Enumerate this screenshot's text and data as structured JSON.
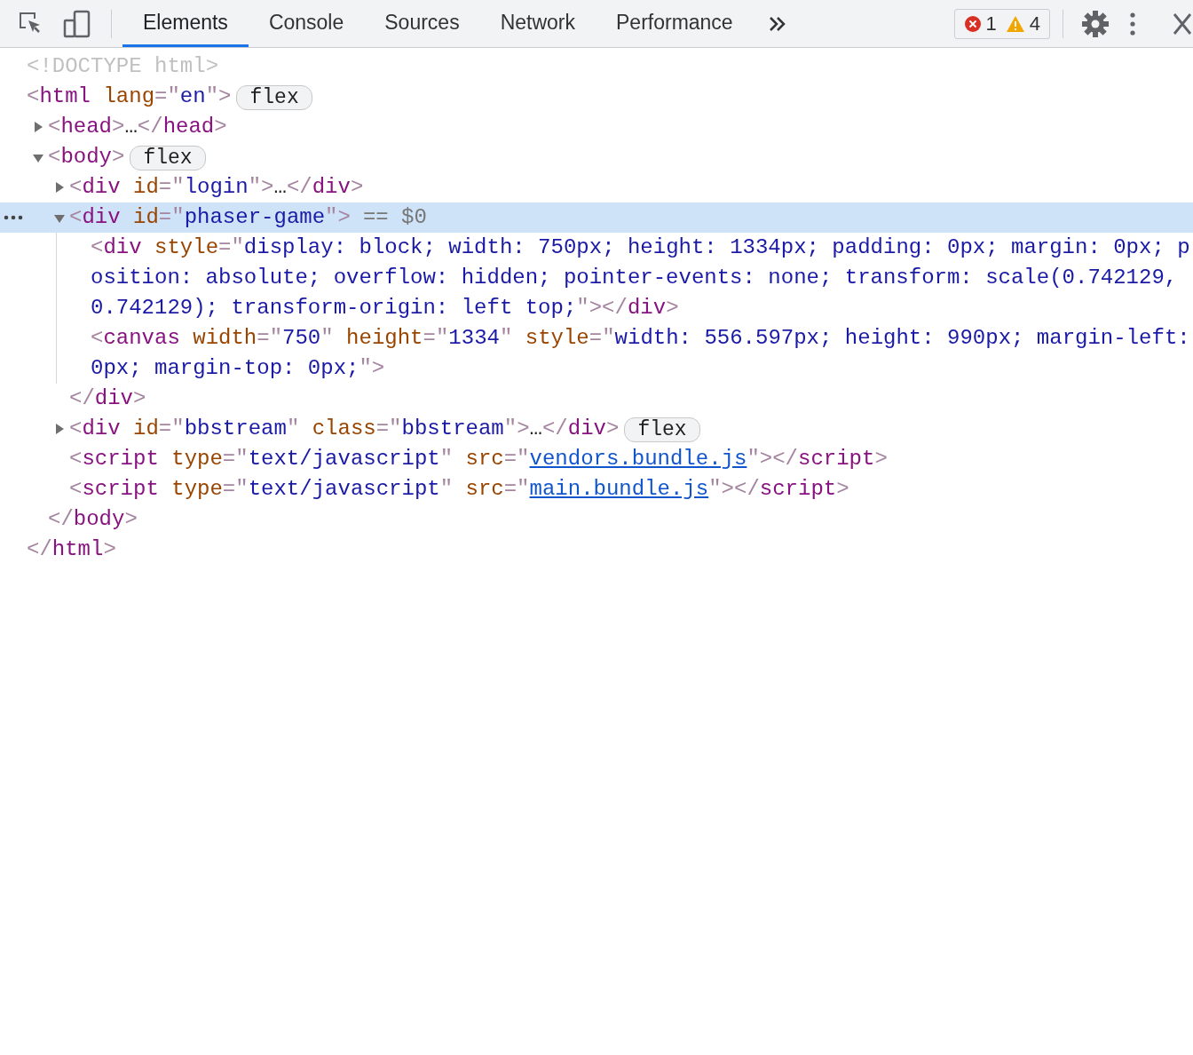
{
  "toolbar": {
    "tabs": [
      {
        "label": "Elements",
        "selected": true
      },
      {
        "label": "Console",
        "selected": false
      },
      {
        "label": "Sources",
        "selected": false
      },
      {
        "label": "Network",
        "selected": false
      },
      {
        "label": "Performance",
        "selected": false
      }
    ],
    "issues": {
      "errors": "1",
      "warnings": "4"
    }
  },
  "dom_tree": [
    {
      "open": [
        {
          "kind": "doctype",
          "text": "<!DOCTYPE html>"
        }
      ]
    },
    {
      "open": [
        {
          "kind": "punct",
          "text": "<"
        },
        {
          "kind": "tag",
          "text": "html"
        },
        {
          "kind": "attr",
          "text": " lang"
        },
        {
          "kind": "punct",
          "text": "=\""
        },
        {
          "kind": "value",
          "text": "en"
        },
        {
          "kind": "punct",
          "text": "\">"
        }
      ],
      "badge": "flex",
      "children": [
        {
          "expanded": false,
          "open": [
            {
              "kind": "punct",
              "text": "<"
            },
            {
              "kind": "tag",
              "text": "head"
            },
            {
              "kind": "punct",
              "text": ">"
            },
            {
              "kind": "ellipsis",
              "text": "…"
            },
            {
              "kind": "punct",
              "text": "</"
            },
            {
              "kind": "tag",
              "text": "head"
            },
            {
              "kind": "punct",
              "text": ">"
            }
          ]
        },
        {
          "expanded": true,
          "open": [
            {
              "kind": "punct",
              "text": "<"
            },
            {
              "kind": "tag",
              "text": "body"
            },
            {
              "kind": "punct",
              "text": ">"
            }
          ],
          "badge": "flex",
          "children": [
            {
              "expanded": false,
              "open": [
                {
                  "kind": "punct",
                  "text": "<"
                },
                {
                  "kind": "tag",
                  "text": "div"
                },
                {
                  "kind": "attr",
                  "text": " id"
                },
                {
                  "kind": "punct",
                  "text": "=\""
                },
                {
                  "kind": "value",
                  "text": "login"
                },
                {
                  "kind": "punct",
                  "text": "\">"
                },
                {
                  "kind": "ellipsis",
                  "text": "…"
                },
                {
                  "kind": "punct",
                  "text": "</"
                },
                {
                  "kind": "tag",
                  "text": "div"
                },
                {
                  "kind": "punct",
                  "text": ">"
                }
              ]
            },
            {
              "expanded": true,
              "selected": true,
              "marker": "== $0",
              "open": [
                {
                  "kind": "punct",
                  "text": "<"
                },
                {
                  "kind": "tag",
                  "text": "div"
                },
                {
                  "kind": "attr",
                  "text": " id"
                },
                {
                  "kind": "punct",
                  "text": "=\""
                },
                {
                  "kind": "value",
                  "text": "phaser-game"
                },
                {
                  "kind": "punct",
                  "text": "\">"
                }
              ],
              "children": [
                {
                  "open": [
                    {
                      "kind": "punct",
                      "text": "<"
                    },
                    {
                      "kind": "tag",
                      "text": "div"
                    },
                    {
                      "kind": "attr",
                      "text": " style"
                    },
                    {
                      "kind": "punct",
                      "text": "=\""
                    },
                    {
                      "kind": "value",
                      "text": "display: block; width: 750px; height: 1334px; padding: 0px; margin: 0px; position: absolute; overflow: hidden; pointer-events: none; transform: scale(0.742129, 0.742129); transform-origin: left top;"
                    },
                    {
                      "kind": "punct",
                      "text": "\"></"
                    },
                    {
                      "kind": "tag",
                      "text": "div"
                    },
                    {
                      "kind": "punct",
                      "text": ">"
                    }
                  ]
                },
                {
                  "open": [
                    {
                      "kind": "punct",
                      "text": "<"
                    },
                    {
                      "kind": "tag",
                      "text": "canvas"
                    },
                    {
                      "kind": "attr",
                      "text": " width"
                    },
                    {
                      "kind": "punct",
                      "text": "=\""
                    },
                    {
                      "kind": "value",
                      "text": "750"
                    },
                    {
                      "kind": "punct",
                      "text": "\""
                    },
                    {
                      "kind": "attr",
                      "text": " height"
                    },
                    {
                      "kind": "punct",
                      "text": "=\""
                    },
                    {
                      "kind": "value",
                      "text": "1334"
                    },
                    {
                      "kind": "punct",
                      "text": "\""
                    },
                    {
                      "kind": "attr",
                      "text": " style"
                    },
                    {
                      "kind": "punct",
                      "text": "=\""
                    },
                    {
                      "kind": "value",
                      "text": "width: 556.597px; height: 990px; margin-left: 0px; margin-top: 0px;"
                    },
                    {
                      "kind": "punct",
                      "text": "\">"
                    }
                  ]
                }
              ],
              "close": [
                {
                  "kind": "punct",
                  "text": "</"
                },
                {
                  "kind": "tag",
                  "text": "div"
                },
                {
                  "kind": "punct",
                  "text": ">"
                }
              ]
            },
            {
              "expanded": false,
              "badge": "flex",
              "open": [
                {
                  "kind": "punct",
                  "text": "<"
                },
                {
                  "kind": "tag",
                  "text": "div"
                },
                {
                  "kind": "attr",
                  "text": " id"
                },
                {
                  "kind": "punct",
                  "text": "=\""
                },
                {
                  "kind": "value",
                  "text": "bbstream"
                },
                {
                  "kind": "punct",
                  "text": "\""
                },
                {
                  "kind": "attr",
                  "text": " class"
                },
                {
                  "kind": "punct",
                  "text": "=\""
                },
                {
                  "kind": "value",
                  "text": "bbstream"
                },
                {
                  "kind": "punct",
                  "text": "\">"
                },
                {
                  "kind": "ellipsis",
                  "text": "…"
                },
                {
                  "kind": "punct",
                  "text": "</"
                },
                {
                  "kind": "tag",
                  "text": "div"
                },
                {
                  "kind": "punct",
                  "text": ">"
                }
              ]
            },
            {
              "open": [
                {
                  "kind": "punct",
                  "text": "<"
                },
                {
                  "kind": "tag",
                  "text": "script"
                },
                {
                  "kind": "attr",
                  "text": " type"
                },
                {
                  "kind": "punct",
                  "text": "=\""
                },
                {
                  "kind": "value",
                  "text": "text/javascript"
                },
                {
                  "kind": "punct",
                  "text": "\""
                },
                {
                  "kind": "attr",
                  "text": " src"
                },
                {
                  "kind": "punct",
                  "text": "=\""
                },
                {
                  "kind": "link",
                  "text": "vendors.bundle.js"
                },
                {
                  "kind": "punct",
                  "text": "\"></"
                },
                {
                  "kind": "tag",
                  "text": "script"
                },
                {
                  "kind": "punct",
                  "text": ">"
                }
              ]
            },
            {
              "open": [
                {
                  "kind": "punct",
                  "text": "<"
                },
                {
                  "kind": "tag",
                  "text": "script"
                },
                {
                  "kind": "attr",
                  "text": " type"
                },
                {
                  "kind": "punct",
                  "text": "=\""
                },
                {
                  "kind": "value",
                  "text": "text/javascript"
                },
                {
                  "kind": "punct",
                  "text": "\""
                },
                {
                  "kind": "attr",
                  "text": " src"
                },
                {
                  "kind": "punct",
                  "text": "=\""
                },
                {
                  "kind": "link",
                  "text": "main.bundle.js"
                },
                {
                  "kind": "punct",
                  "text": "\"></"
                },
                {
                  "kind": "tag",
                  "text": "script"
                },
                {
                  "kind": "punct",
                  "text": ">"
                }
              ]
            }
          ],
          "close": [
            {
              "kind": "punct",
              "text": "</"
            },
            {
              "kind": "tag",
              "text": "body"
            },
            {
              "kind": "punct",
              "text": ">"
            }
          ]
        }
      ],
      "close": [
        {
          "kind": "punct",
          "text": "</"
        },
        {
          "kind": "tag",
          "text": "html"
        },
        {
          "kind": "punct",
          "text": ">"
        }
      ]
    }
  ]
}
